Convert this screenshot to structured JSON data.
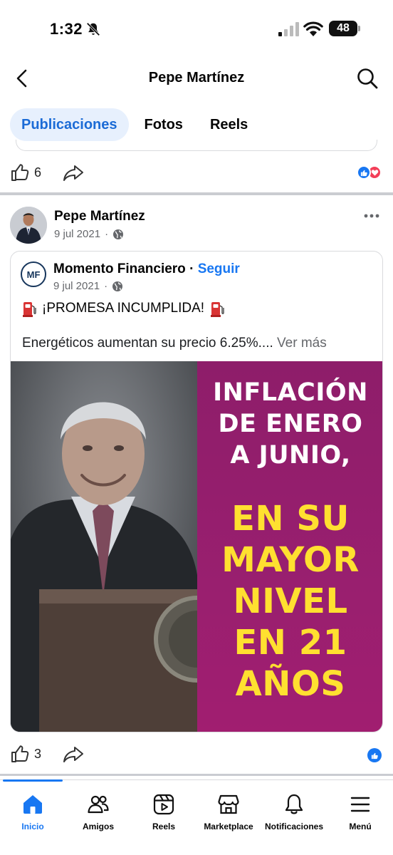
{
  "status_bar": {
    "time": "1:32",
    "battery": "48"
  },
  "header": {
    "title": "Pepe Martínez"
  },
  "tabs": [
    {
      "label": "Publicaciones",
      "active": true
    },
    {
      "label": "Fotos",
      "active": false
    },
    {
      "label": "Reels",
      "active": false
    }
  ],
  "previous_post": {
    "like_count": "6",
    "reactions": [
      "like",
      "love"
    ]
  },
  "post": {
    "author": "Pepe Martínez",
    "date": "9 jul 2021",
    "shared": {
      "page_name": "Momento Financiero",
      "separator": " · ",
      "follow_label": "Seguir",
      "logo_text": "MF",
      "date": "9 jul 2021",
      "headline": "¡PROMESA INCUMPLIDA!",
      "body": "Energéticos aumentan su precio 6.25%....",
      "see_more": "Ver más",
      "image": {
        "line1": "INFLACIÓN",
        "line2": "DE ENERO",
        "line3": "A JUNIO,",
        "line4": "EN SU",
        "line5": "MAYOR",
        "line6": "NIVEL",
        "line7": "EN 21",
        "line8": "AÑOS"
      }
    },
    "like_count": "3"
  },
  "nav": [
    {
      "label": "Inicio",
      "icon": "home-icon",
      "active": true
    },
    {
      "label": "Amigos",
      "icon": "friends-icon",
      "active": false
    },
    {
      "label": "Reels",
      "icon": "reels-icon",
      "active": false
    },
    {
      "label": "Marketplace",
      "icon": "marketplace-icon",
      "active": false
    },
    {
      "label": "Notificaciones",
      "icon": "bell-icon",
      "active": false
    },
    {
      "label": "Menú",
      "icon": "menu-icon",
      "active": false
    }
  ],
  "colors": {
    "accent": "#1877f2",
    "panel_purple": "#991f6f",
    "headline_yellow": "#ffe030",
    "tab_active_bg": "#e7f0fd"
  }
}
